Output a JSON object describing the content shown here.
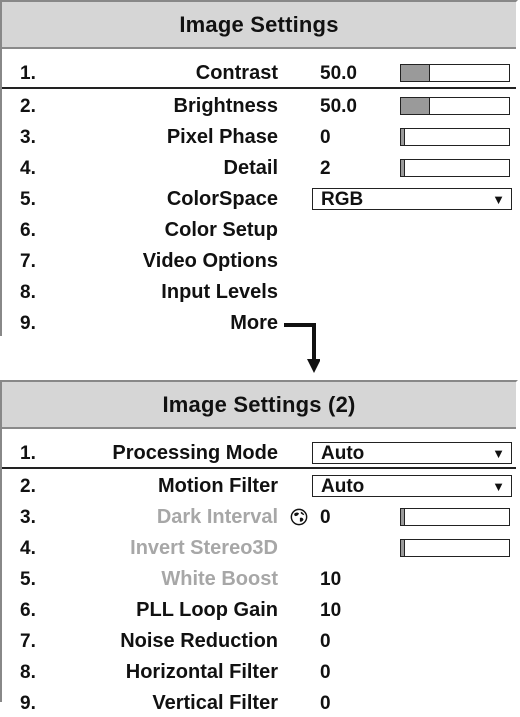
{
  "menu1": {
    "title": "Image Settings",
    "rows": [
      {
        "num": "1.",
        "label": "Contrast",
        "value": "50.0",
        "bar": 0.26
      },
      {
        "num": "2.",
        "label": "Brightness",
        "value": "50.0",
        "bar": 0.26
      },
      {
        "num": "3.",
        "label": "Pixel Phase",
        "value": "0",
        "bar": 0.0
      },
      {
        "num": "4.",
        "label": "Detail",
        "value": "2",
        "bar": 0.03
      },
      {
        "num": "5.",
        "label": "ColorSpace",
        "dropdown": "RGB"
      },
      {
        "num": "6.",
        "label": "Color Setup"
      },
      {
        "num": "7.",
        "label": "Video Options"
      },
      {
        "num": "8.",
        "label": "Input Levels"
      },
      {
        "num": "9.",
        "label": "More"
      }
    ]
  },
  "menu2": {
    "title": "Image Settings (2)",
    "rows": [
      {
        "num": "1.",
        "label": "Processing Mode",
        "dropdown": "Auto"
      },
      {
        "num": "2.",
        "label": "Motion Filter",
        "dropdown": "Auto"
      },
      {
        "num": "3.",
        "label": "Dark Interval",
        "value": "0",
        "bar": 0.0,
        "disabled": true,
        "globe": true
      },
      {
        "num": "4.",
        "label": "Invert Stereo3D",
        "bar": 0.03,
        "disabled": true
      },
      {
        "num": "5.",
        "label": "White Boost",
        "value": "10",
        "disabled": true
      },
      {
        "num": "6.",
        "label": "PLL Loop Gain",
        "value": "10"
      },
      {
        "num": "7.",
        "label": "Noise Reduction",
        "value": "0"
      },
      {
        "num": "8.",
        "label": "Horizontal Filter",
        "value": "0"
      },
      {
        "num": "9.",
        "label": "Vertical Filter",
        "value": "0"
      }
    ]
  },
  "icons": {
    "dropdown_arrow": "triangle-down-icon",
    "globe": "globe-icon",
    "more_arrow": "connector-arrow-icon"
  }
}
